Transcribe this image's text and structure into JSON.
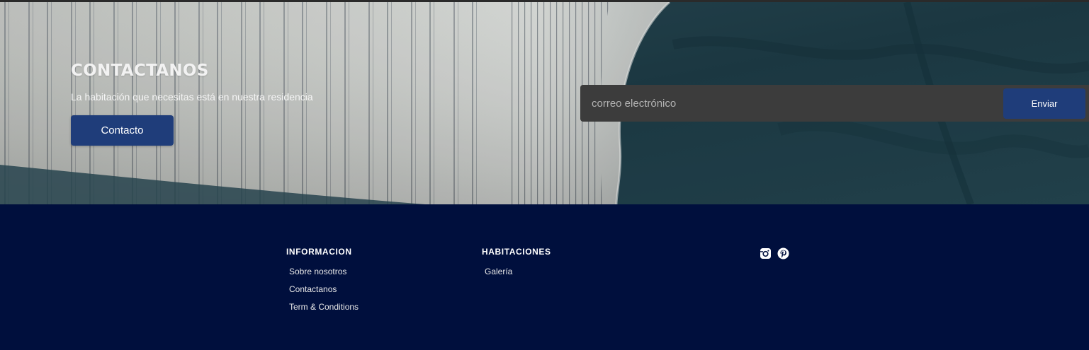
{
  "hero": {
    "title": "CONTACTANOS",
    "subtitle": "La habitación que necesitas está en nuestra residencia",
    "contact_button": "Contacto",
    "email_placeholder": "correo electrónico",
    "send_button": "Enviar"
  },
  "footer": {
    "info": {
      "heading": "INFORMACION",
      "links": [
        "Sobre nosotros",
        "Contactanos",
        "Term & Conditions"
      ]
    },
    "rooms": {
      "heading": "HABITACIONES",
      "links": [
        "Galería"
      ]
    },
    "social": [
      "instagram-icon",
      "pinterest-icon"
    ]
  },
  "colors": {
    "footer_bg": "#000f3d",
    "button_bg": "#1f3d7a",
    "input_bg": "#3c3c3c"
  }
}
